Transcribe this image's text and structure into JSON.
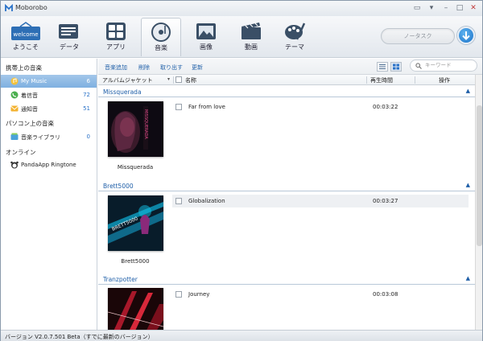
{
  "app": {
    "title": "Moborobo"
  },
  "window_controls": [
    "feedback",
    "menu",
    "minimize",
    "maximize",
    "close"
  ],
  "toolbar": {
    "items": [
      {
        "label": "ようこそ",
        "icon": "welcome-icon"
      },
      {
        "label": "データ",
        "icon": "data-icon"
      },
      {
        "label": "アプリ",
        "icon": "apps-icon"
      },
      {
        "label": "音楽",
        "icon": "music-icon",
        "active": true
      },
      {
        "label": "画像",
        "icon": "image-icon"
      },
      {
        "label": "動画",
        "icon": "video-icon"
      },
      {
        "label": "テーマ",
        "icon": "theme-icon"
      }
    ],
    "search_placeholder": "ノータスク",
    "welcome_badge": "welcome"
  },
  "sidebar": {
    "section1": "携帯上の音楽",
    "phone_items": [
      {
        "label": "My Music",
        "count": "6",
        "selected": true
      },
      {
        "label": "着信音",
        "count": "72"
      },
      {
        "label": "通知音",
        "count": "51"
      }
    ],
    "section2": "パソコン上の音楽",
    "pc_items": [
      {
        "label": "音楽ライブラリ",
        "count": "0"
      }
    ],
    "section3": "オンライン",
    "online_items": [
      {
        "label": "PandaApp Ringtone"
      }
    ]
  },
  "actions": {
    "add": "音楽追加",
    "delete": "削除",
    "export": "取り出す",
    "refresh": "更新",
    "keyword_placeholder": "キーワード"
  },
  "columns": {
    "jacket": "アルバムジャケット",
    "name": "名称",
    "duration": "再生時間",
    "operation": "操作"
  },
  "groups": [
    {
      "artist": "Missquerada",
      "album_label": "Missquerada",
      "album_art_text": "MISSQUERADA",
      "tracks": [
        {
          "title": "Far from love",
          "duration": "00:03:22"
        }
      ]
    },
    {
      "artist": "Brett5000",
      "album_label": "Brett5000",
      "album_art_text": "BRETT5000",
      "tracks": [
        {
          "title": "Globalization",
          "duration": "00:03:27",
          "highlight": true
        }
      ]
    },
    {
      "artist": "Tranzpotter",
      "album_label": "",
      "album_art_text": "",
      "tracks": [
        {
          "title": "Journey",
          "duration": "00:03:08"
        }
      ]
    }
  ],
  "status": {
    "version_text": "バージョン V2.0.7.501 Beta（すでに最新のバージョン）"
  },
  "colors": {
    "accent": "#2a72c8",
    "selected": "#7eb0e0",
    "group_title": "#1f5fa8"
  }
}
